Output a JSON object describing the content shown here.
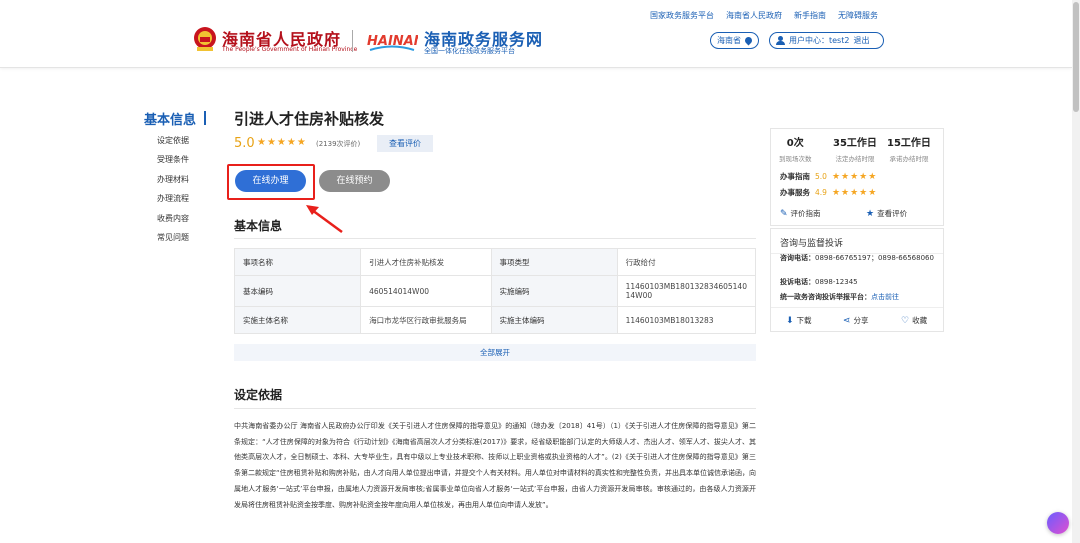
{
  "header": {
    "gov_title": "海南省人民政府",
    "gov_subtitle": "The People's Government of Hainan Province",
    "logo_text": "HAINAN",
    "service_title": "海南政务服务网",
    "service_subtitle": "全国一体化在线政务服务平台",
    "top_links": [
      "国家政务服务平台",
      "海南省人民政府",
      "新手指南",
      "无障碍服务"
    ],
    "region": "海南省",
    "user_label": "用户中心：test2",
    "logout": "退出"
  },
  "nav": {
    "title": "基本信息",
    "items": [
      "设定依据",
      "受理条件",
      "办理材料",
      "办理流程",
      "收费内容",
      "常见问题"
    ]
  },
  "main": {
    "title": "引进人才住房补贴核发",
    "rating": "5.0",
    "stars": "★★★★★",
    "rating_count": "(2139次评价)",
    "view_eval": "查看评价",
    "btn_online": "在线办理",
    "btn_book": "在线预约",
    "section_basic": "基本信息",
    "table": [
      [
        "事项名称",
        "引进人才住房补贴核发",
        "事项类型",
        "行政给付"
      ],
      [
        "基本编码",
        "460514014W00",
        "实施编码",
        "11460103MB180132834605140 14W00"
      ],
      [
        "实施主体名称",
        "海口市龙华区行政审批服务局",
        "实施主体编码",
        "11460103MB18013283"
      ]
    ],
    "expand": "全部展开",
    "section_basis": "设定依据",
    "basis_text": "中共海南省委办公厅 海南省人民政府办公厅印发《关于引进人才住房保障的指导意见》的通知（琼办发〔2018〕41号）（1）《关于引进人才住房保障的指导意见》第二条规定：“人才住房保障的对象为符合《行动计划》《海南省高层次人才分类标准(2017)》要求，经省级职能部门认定的大师级人才、杰出人才、领军人才、拔尖人才、其他类高层次人才，全日制硕士、本科、大专毕业生，具有中级以上专业技术职称、技师以上职业资格或执业资格的人才”。(2)《关于引进人才住房保障的指导意见》第三条第二款规定“住房租赁补贴和购房补贴，由人才向用人单位提出申请，并提交个人有关材料。用人单位对申请材料的真实性和完整性负责，并出具本单位诚信承诺函，向属地人才服务‘一站式’平台申报，由属地人力资源开发局审核;省属事业单位向省人才服务‘一站式’平台申报，由省人力资源开发局审核。审核通过的，由各级人力资源开发局将住房租赁补贴资金按季度、购房补贴资金按年度向用人单位核发，再由用人单位向申请人发放”。"
  },
  "right_panel": {
    "stats": [
      {
        "value": "0次",
        "label": "到现场次数"
      },
      {
        "value": "35工作日",
        "label": "法定办结时限"
      },
      {
        "value": "15工作日",
        "label": "承诺办结时限"
      }
    ],
    "guide_label": "办事指南",
    "guide_score": "5.0",
    "service_label": "办事服务",
    "service_score": "4.9",
    "stars": "★★★★★",
    "eval_guide": "评价指南",
    "view_eval": "查看评价",
    "consult_title": "咨询与监督投诉",
    "consult_label": "咨询电话：",
    "consult_phone": "0898-66765197；0898-66568060",
    "complaint_label": "投诉电话：",
    "complaint_phone": "0898-12345",
    "platform_label": "统一政务咨询投诉举报平台：",
    "platform_link": "点击前往",
    "download": "下载",
    "share": "分享",
    "favorite": "收藏"
  },
  "colors": {
    "brand_red": "#b4101b",
    "brand_blue": "#1a5fb4",
    "primary_button": "#2f6fd6",
    "star": "#f5a623",
    "highlight": "#e8201b"
  }
}
